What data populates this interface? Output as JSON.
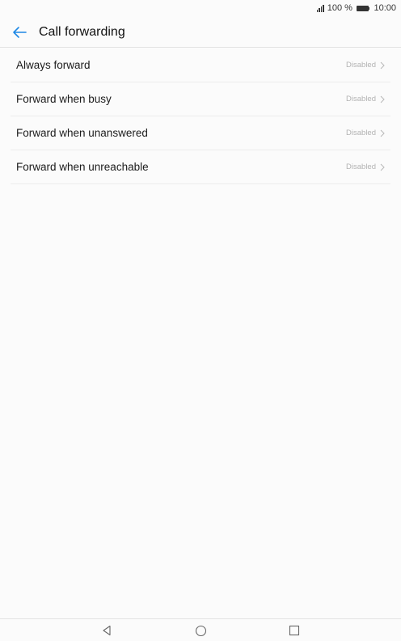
{
  "status_bar": {
    "battery_percent": "100 %",
    "time": "10:00",
    "icons": [
      "signal-icon",
      "battery-icon"
    ]
  },
  "header": {
    "title": "Call forwarding",
    "back_icon": "arrow-left-icon"
  },
  "items": [
    {
      "label": "Always forward",
      "value": "Disabled"
    },
    {
      "label": "Forward when busy",
      "value": "Disabled"
    },
    {
      "label": "Forward when unanswered",
      "value": "Disabled"
    },
    {
      "label": "Forward when unreachable",
      "value": "Disabled"
    }
  ],
  "nav_bar": {
    "icons": [
      "back-triangle-icon",
      "home-circle-icon",
      "recents-square-icon"
    ]
  },
  "colors": {
    "accent": "#1e88e5",
    "background": "#fbfbfb",
    "secondary_text": "#b3b3b3"
  }
}
